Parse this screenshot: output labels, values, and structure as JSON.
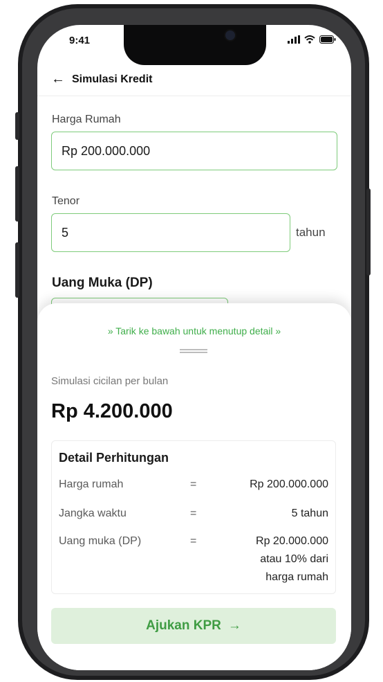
{
  "status_bar": {
    "time": "9:41",
    "icons": [
      "signal-icon",
      "wifi-icon",
      "battery-icon"
    ]
  },
  "header": {
    "back_icon": "arrow-left-icon",
    "title": "Simulasi Kredit"
  },
  "form": {
    "price": {
      "label": "Harga Rumah",
      "value": "Rp 200.000.000"
    },
    "tenor": {
      "label": "Tenor",
      "value": "5",
      "suffix": "tahun"
    },
    "down_payment": {
      "label": "Uang Muka (DP)"
    }
  },
  "sheet": {
    "pull_hint": "Tarik ke bawah untuk menutup detail",
    "pull_hint_icon": "chevrons-down-icon",
    "simulation_label": "Simulasi cicilan per bulan",
    "simulation_amount": "Rp 4.200.000",
    "details": {
      "title": "Detail Perhitungan",
      "rows": [
        {
          "label": "Harga rumah",
          "eq": "=",
          "value": "Rp 200.000.000"
        },
        {
          "label": "Jangka waktu",
          "eq": "=",
          "value": "5 tahun"
        },
        {
          "label": "Uang muka (DP)",
          "eq": "=",
          "value_lines": [
            "Rp 20.000.000",
            "atau 10% dari",
            "harga rumah"
          ]
        }
      ]
    },
    "cta": {
      "label": "Ajukan KPR",
      "icon": "arrow-right-icon"
    }
  },
  "colors": {
    "accent": "#3fae4a",
    "border": "#7ecb7a",
    "cta_bg": "#dff0dc",
    "cta_text": "#3f9c43"
  }
}
